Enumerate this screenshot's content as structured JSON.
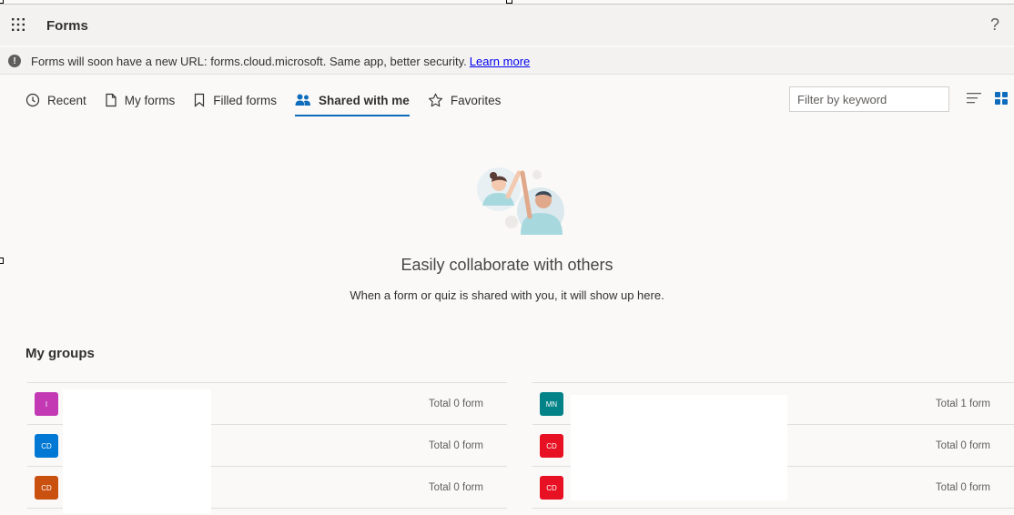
{
  "app": {
    "title": "Forms",
    "help_label": "?"
  },
  "banner": {
    "icon": "info-icon",
    "text": "Forms will soon have a new URL: forms.cloud.microsoft. Same app, better security.",
    "link": "Learn more"
  },
  "tabs": [
    {
      "label": "Recent",
      "icon": "clock-icon",
      "active": false
    },
    {
      "label": "My forms",
      "icon": "document-icon",
      "active": false
    },
    {
      "label": "Filled forms",
      "icon": "bookmark-icon",
      "active": false
    },
    {
      "label": "Shared with me",
      "icon": "people-icon",
      "active": true
    },
    {
      "label": "Favorites",
      "icon": "star-icon",
      "active": false
    }
  ],
  "filter": {
    "placeholder": "Filter by keyword",
    "value": ""
  },
  "view": {
    "selected": "grid"
  },
  "empty_state": {
    "title": "Easily collaborate with others",
    "subtitle": "When a form or quiz is shared with you, it will show up here."
  },
  "groups": {
    "title": "My groups",
    "left": [
      {
        "initials": "I",
        "color": "#c239b3",
        "total": "Total 0 form"
      },
      {
        "initials": "CD",
        "color": "#0078d4",
        "total": "Total 0 form"
      },
      {
        "initials": "CD",
        "color": "#ca5010",
        "total": "Total 0 form"
      }
    ],
    "right": [
      {
        "initials": "MN",
        "color": "#038387",
        "total": "Total 1 form"
      },
      {
        "initials": "CD",
        "color": "#e81123",
        "total": "Total 0 form"
      },
      {
        "initials": "CD",
        "color": "#e81123",
        "total": "Total 0 form"
      }
    ]
  }
}
